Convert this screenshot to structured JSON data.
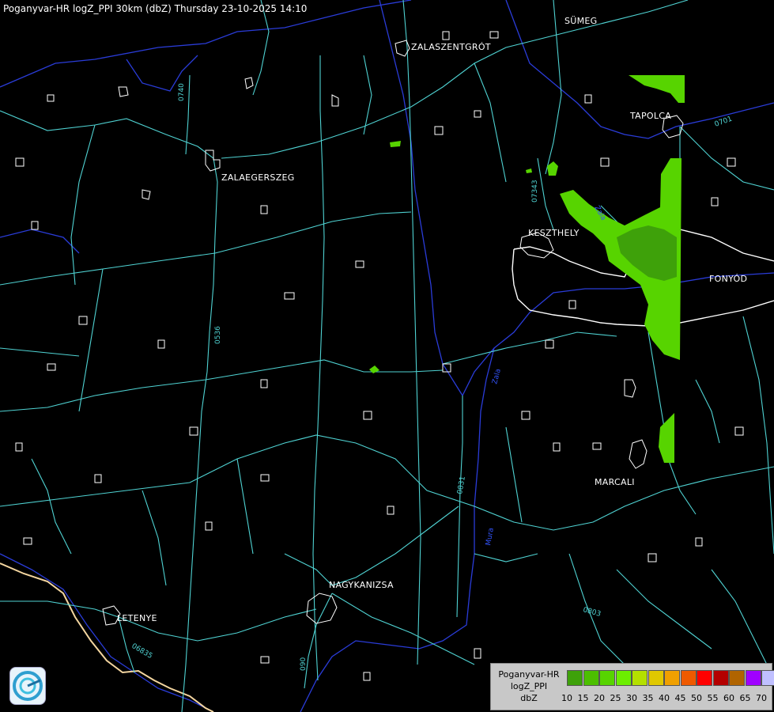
{
  "header": {
    "title": "Poganyvar-HR logZ_PPI 30km (dbZ) Thursday 23-10-2025 14:10"
  },
  "cities": [
    {
      "name": "SÜMEG"
    },
    {
      "name": "ZALASZENTGRÓT"
    },
    {
      "name": "TAPOLCA"
    },
    {
      "name": "ZALAEGERSZEG"
    },
    {
      "name": "KESZTHELY"
    },
    {
      "name": "FONYÓD"
    },
    {
      "name": "MARCALI"
    },
    {
      "name": "NAGYKANIZSA"
    },
    {
      "name": "LETENYE"
    }
  ],
  "road_labels": [
    "0740",
    "07343",
    "0536",
    "0831",
    "0803",
    "06835",
    "0701",
    "090"
  ],
  "river_labels": [
    "Zala",
    "Zala",
    "Mura"
  ],
  "legend": {
    "line1": "Poganyvar-HR",
    "line2": "logZ_PPI",
    "line3": "dbZ",
    "ticks": [
      "10",
      "15",
      "20",
      "25",
      "30",
      "35",
      "40",
      "45",
      "50",
      "55",
      "60",
      "65",
      "70"
    ],
    "colors": [
      "#3ea10a",
      "#4cbf00",
      "#57d400",
      "#6cee00",
      "#b4e000",
      "#e0c800",
      "#f0a000",
      "#ef5a00",
      "#ff0000",
      "#b40000",
      "#b06400",
      "#a000ff",
      "#c0c0ff"
    ]
  },
  "colors": {
    "background": "#000000",
    "road": "#4fd2d2",
    "river": "#2a3cd8",
    "border": "#f4d6a0",
    "echo_light": "#57d400",
    "echo_dark": "#3ea10a"
  },
  "logo": {
    "icon": "radar-service-logo-icon"
  }
}
